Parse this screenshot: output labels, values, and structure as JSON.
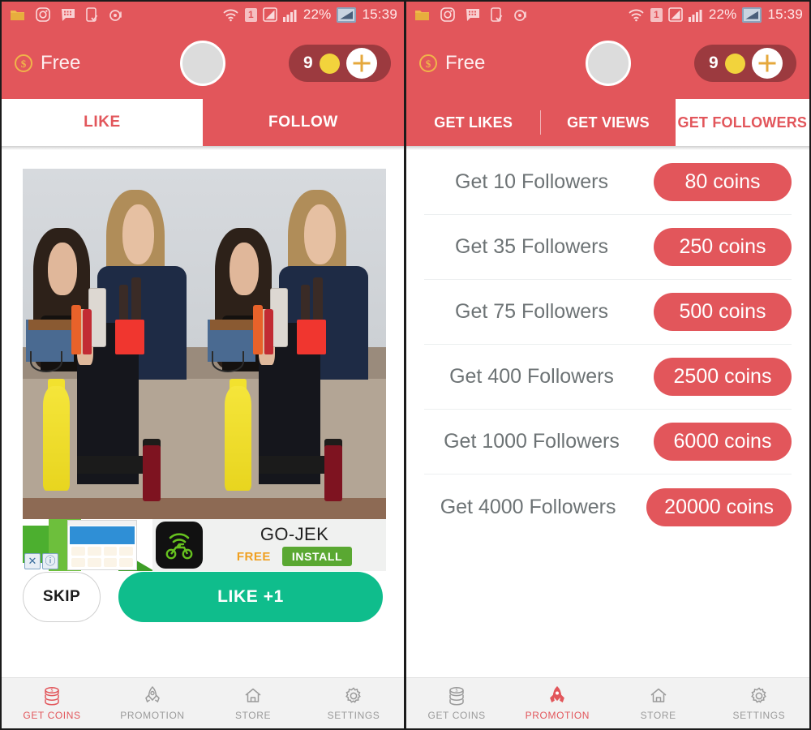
{
  "status_bar": {
    "left_icons": [
      "folder-icon",
      "instagram-icon",
      "bbm-chat-icon",
      "device-icon",
      "alarm-icon"
    ],
    "wifi_icon": "wifi-icon",
    "sim_badge": "1",
    "signal_icon": "signal-icon",
    "bars_icon": "signal-bars-icon",
    "battery_percent": "22%",
    "battery_icon": "battery-icon",
    "time": "15:39"
  },
  "app_bar": {
    "plan_label": "Free",
    "plan_icon": "dollar-coin-icon",
    "avatar": "user-avatar",
    "coin_count": "9",
    "coin_icon": "coin-icon",
    "add_coins_icon": "plus-icon"
  },
  "left_screen": {
    "tabs": [
      {
        "label": "LIKE",
        "active": true
      },
      {
        "label": "FOLLOW",
        "active": false
      }
    ],
    "photo": {
      "alt": "mirror-selfie-two-women",
      "duplicated": true
    },
    "ad": {
      "title": "GO-JEK",
      "price_label": "FREE",
      "install_label": "INSTALL",
      "close_icon": "close-icon",
      "info_icon": "info-icon",
      "app_icon": "gojek-motorbike-icon"
    },
    "skip_label": "SKIP",
    "like_label": "LIKE +1"
  },
  "right_screen": {
    "tabs": [
      {
        "label": "GET LIKES",
        "active": false
      },
      {
        "label": "GET VIEWS",
        "active": false
      },
      {
        "label": "GET FOLLOWERS",
        "active": true
      }
    ],
    "offers": [
      {
        "label": "Get 10 Followers",
        "price": "80 coins"
      },
      {
        "label": "Get 35 Followers",
        "price": "250 coins"
      },
      {
        "label": "Get 75 Followers",
        "price": "500 coins"
      },
      {
        "label": "Get 400 Followers",
        "price": "2500 coins"
      },
      {
        "label": "Get 1000 Followers",
        "price": "6000 coins"
      },
      {
        "label": "Get 4000 Followers",
        "price": "20000 coins"
      }
    ]
  },
  "bottom_nav_left": [
    {
      "label": "GET COINS",
      "icon": "coins-stack-icon",
      "active": true
    },
    {
      "label": "PROMOTION",
      "icon": "rocket-icon",
      "active": false
    },
    {
      "label": "STORE",
      "icon": "home-icon",
      "active": false
    },
    {
      "label": "SETTINGS",
      "icon": "gear-icon",
      "active": false
    }
  ],
  "bottom_nav_right": [
    {
      "label": "GET COINS",
      "icon": "coins-stack-icon",
      "active": false
    },
    {
      "label": "PROMOTION",
      "icon": "rocket-icon",
      "active": true
    },
    {
      "label": "STORE",
      "icon": "home-icon",
      "active": false
    },
    {
      "label": "SETTINGS",
      "icon": "gear-icon",
      "active": false
    }
  ],
  "colors": {
    "brand_red": "#e2565b",
    "coin_pill_dark": "#9c3a3f",
    "green_cta": "#0fbd8c",
    "gold": "#f2d33c",
    "nav_bg": "#f2f2f2",
    "list_text": "#6d7375"
  }
}
